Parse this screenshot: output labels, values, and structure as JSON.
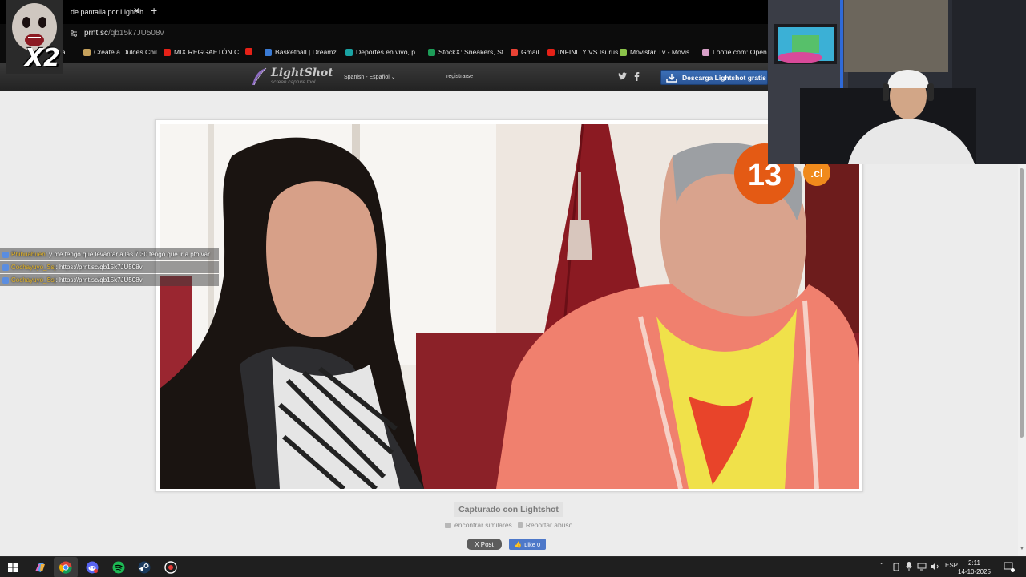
{
  "browser": {
    "tab_title": "de pantalla por Lightsh",
    "tab_close": "✕",
    "new_tab": "+",
    "url_host": "prnt.sc",
    "url_path": "/qb15k7JU508v",
    "bookmarks": [
      {
        "label": "nja",
        "color": "#555555"
      },
      {
        "label": "Create a Dulces Chil...",
        "color": "#c6a15b"
      },
      {
        "label": "MIX REGGAETÓN C...",
        "color": "#e62117"
      },
      {
        "label": "",
        "color": "#e62117"
      },
      {
        "label": "Basketball | Dreamz...",
        "color": "#3a7bd5"
      },
      {
        "label": "Deportes en vivo, p...",
        "color": "#1aa3a3"
      },
      {
        "label": "StockX: Sneakers, St...",
        "color": "#1d9d58"
      },
      {
        "label": "Gmail",
        "color": "#ea4335"
      },
      {
        "label": "INFINITY VS Isurus",
        "color": "#e62117"
      },
      {
        "label": "Movistar Tv - Movis...",
        "color": "#8bc34a"
      },
      {
        "label": "Lootie.com: Open...",
        "color": "#d8a0c8"
      }
    ]
  },
  "lightshot": {
    "brand": "LightShot",
    "tagline": "screen capture tool",
    "language": "Spanish - Español",
    "register": "registrarse",
    "download_button": "Descarga Lightshot gratis",
    "captured_label": "Capturado con Lightshot",
    "find_similar": "encontrar similares",
    "report_abuse": "Reportar abuso",
    "x_post": "X Post",
    "fb_like": "Like 0",
    "channel_logo": "13",
    "channel_logo_suffix": ".cl"
  },
  "chat": [
    {
      "user": "Phihuahuen",
      "message": ": y me tengo que levantar a las 7:30 tengo que ir a pto var"
    },
    {
      "user": "Cochayuyo_Ssj",
      "message": ": https://prnt.sc/qb15k7JU508v"
    },
    {
      "user": "Cochayuyo_Ssj",
      "message": ": https://prnt.sc/qb15k7JU508v"
    }
  ],
  "emote": {
    "multiplier": "X2"
  },
  "taskbar": {
    "language": "ESP",
    "time": "2:11",
    "date": "14-10-2025"
  },
  "colors": {
    "lightshot_blue": "#2f5fa6",
    "header_dark": "#2d2d2d",
    "page_bg": "#ececec"
  }
}
